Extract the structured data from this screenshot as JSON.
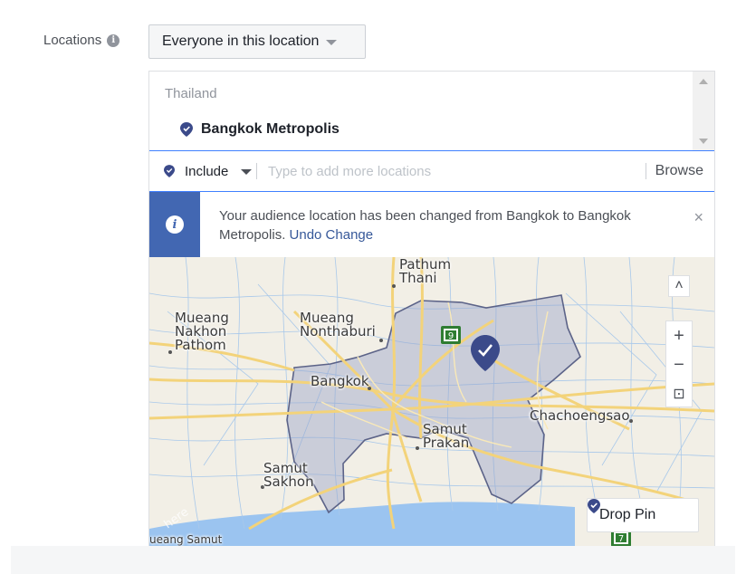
{
  "locations": {
    "label": "Locations",
    "info_icon": "info-icon",
    "dropdown_value": "Everyone in this location"
  },
  "selected": {
    "country": "Thailand",
    "city": "Bangkok Metropolis",
    "pin_icon": "location-pin-icon"
  },
  "search": {
    "mode": "Include",
    "placeholder": "Type to add more locations",
    "value": "",
    "browse_label": "Browse"
  },
  "notice": {
    "text": "Your audience location has been changed from Bangkok to Bangkok Metropolis.",
    "link": "Undo Change",
    "close": "×"
  },
  "map": {
    "labels": {
      "pathum_thani": "Pathum\nThani",
      "nakhon_pathom": "Mueang\nNakhon\nPathom",
      "nonthaburi": "Mueang\nNonthaburi",
      "bangkok": "Bangkok",
      "samut_prakan": "Samut\nPrakan",
      "samut_sakhon": "Samut\nSakhon",
      "chachoengsao": "Chachoengsao",
      "bottom_left": "ueang Samut",
      "route_9": "9",
      "route_7": "7",
      "watermark": "here"
    },
    "controls": {
      "collapse": "˄",
      "zoom_in": "+",
      "zoom_out": "−",
      "recenter": "⊡"
    },
    "drop_pin_label": "Drop Pin"
  },
  "colors": {
    "accent": "#4267b2",
    "pin": "#3b4a8a",
    "region_fill": "#9aa3c9",
    "water": "#9bc4f0"
  }
}
